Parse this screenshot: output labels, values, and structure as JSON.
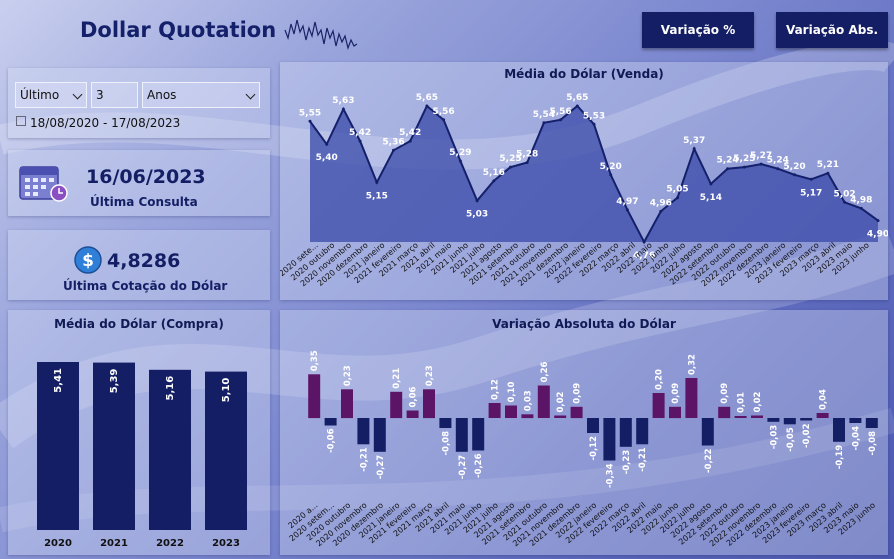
{
  "header": {
    "title": "Dollar Quotation",
    "btn_pct": "Variação %",
    "btn_abs": "Variação Abs."
  },
  "filters": {
    "mode": "Último",
    "amount": "3",
    "unit": "Anos",
    "date_range": "18/08/2020 - 17/08/2023"
  },
  "cards": {
    "consulta": {
      "value": "16/06/2023",
      "label": "Última Consulta",
      "icon": "calendar-icon"
    },
    "cotacao": {
      "value": "4,8286",
      "label": "Última Cotação do Dólar",
      "icon": "dollar-coin-icon"
    }
  },
  "colors": {
    "navy": "#141e64",
    "purple": "#5c1466",
    "area": "#3a4aa8",
    "line": "#14206a"
  },
  "chart_data": [
    {
      "type": "area",
      "title": "Média do Dólar (Venda)",
      "categories": [
        "2020 sete...",
        "2020 outubro",
        "2020 novembro",
        "2020 dezembro",
        "2021 janeiro",
        "2021 fevereiro",
        "2021 março",
        "2021 abril",
        "2021 maio",
        "2021 junho",
        "2021 julho",
        "2021 agosto",
        "2021 setembro",
        "2021 outubro",
        "2021 novembro",
        "2021 dezembro",
        "2022 janeiro",
        "2022 fevereiro",
        "2022 março",
        "2022 abril",
        "2022 maio",
        "2022 junho",
        "2022 julho",
        "2022 agosto",
        "2022 setembro",
        "2022 outubro",
        "2022 novembro",
        "2022 dezembro",
        "2023 janeiro",
        "2023 fevereiro",
        "2023 março",
        "2023 abril",
        "2023 maio",
        "2023 junho"
      ],
      "values": [
        5.55,
        5.4,
        5.63,
        5.42,
        5.15,
        5.36,
        5.42,
        5.65,
        5.56,
        5.29,
        5.03,
        5.16,
        5.25,
        5.28,
        5.54,
        5.56,
        5.65,
        5.53,
        5.2,
        4.97,
        4.76,
        4.96,
        5.05,
        5.37,
        5.14,
        5.24,
        5.25,
        5.27,
        5.24,
        5.2,
        5.17,
        5.21,
        5.02,
        4.98,
        4.9
      ],
      "labels": [
        "5,55",
        "5,40",
        "5,63",
        "5,42",
        "5,15",
        "5,36",
        "5,42",
        "5,65",
        "5,56",
        "5,29",
        "5,03",
        "5,16",
        "5,25",
        "5,28",
        "5,54",
        "5,56",
        "5,65",
        "5,53",
        "5,20",
        "4,97",
        "4,76",
        "4,96",
        "5,05",
        "5,37",
        "5,14",
        "5,24",
        "5,25",
        "5,27",
        "5,24",
        "5,20",
        "5,17",
        "5,21",
        "5,02",
        "4,98",
        "4,90"
      ]
    },
    {
      "type": "bar",
      "title": "Média do Dólar (Compra)",
      "categories": [
        "2020",
        "2021",
        "2022",
        "2023"
      ],
      "values": [
        5.41,
        5.39,
        5.16,
        5.1
      ],
      "labels": [
        "5,41",
        "5,39",
        "5,16",
        "5,10"
      ]
    },
    {
      "type": "bar",
      "title": "Variação Absoluta do Dólar",
      "categories": [
        "2020 a...",
        "2020 setem...",
        "2020 outubro",
        "2020 novembro",
        "2020 dezembro",
        "2021 janeiro",
        "2021 fevereiro",
        "2021 março",
        "2021 abril",
        "2021 maio",
        "2021 junho",
        "2021 julho",
        "2021 agosto",
        "2021 setembro",
        "2021 outubro",
        "2021 novembro",
        "2021 dezembro",
        "2022 janeiro",
        "2022 fevereiro",
        "2022 março",
        "2022 abril",
        "2022 maio",
        "2022 junho",
        "2022 julho",
        "2022 agosto",
        "2022 setembro",
        "2022 outubro",
        "2022 novembro",
        "2022 dezembro",
        "2023 janeiro",
        "2023 fevereiro",
        "2023 março",
        "2023 abril",
        "2023 maio",
        "2023 junho"
      ],
      "values": [
        0.35,
        -0.06,
        0.23,
        -0.21,
        -0.27,
        0.21,
        0.06,
        0.23,
        -0.08,
        -0.27,
        -0.26,
        0.12,
        0.1,
        0.03,
        0.26,
        0.02,
        0.09,
        -0.12,
        -0.34,
        -0.23,
        -0.21,
        0.2,
        0.09,
        0.32,
        -0.22,
        0.09,
        0.01,
        0.02,
        -0.03,
        -0.05,
        -0.02,
        0.04,
        -0.19,
        -0.04,
        -0.08
      ],
      "labels": [
        "0,35",
        "-0,06",
        "0,23",
        "-0,21",
        "-0,27",
        "0,21",
        "0,06",
        "0,23",
        "-0,08",
        "-0,27",
        "-0,26",
        "0,12",
        "0,10",
        "0,03",
        "0,26",
        "0,02",
        "0,09",
        "-0,12",
        "-0,34",
        "-0,23",
        "-0,21",
        "0,20",
        "0,09",
        "0,32",
        "-0,22",
        "0,09",
        "0,01",
        "0,02",
        "-0,03",
        "-0,05",
        "-0,02",
        "0,04",
        "-0,19",
        "-0,04",
        "-0,08"
      ]
    }
  ]
}
